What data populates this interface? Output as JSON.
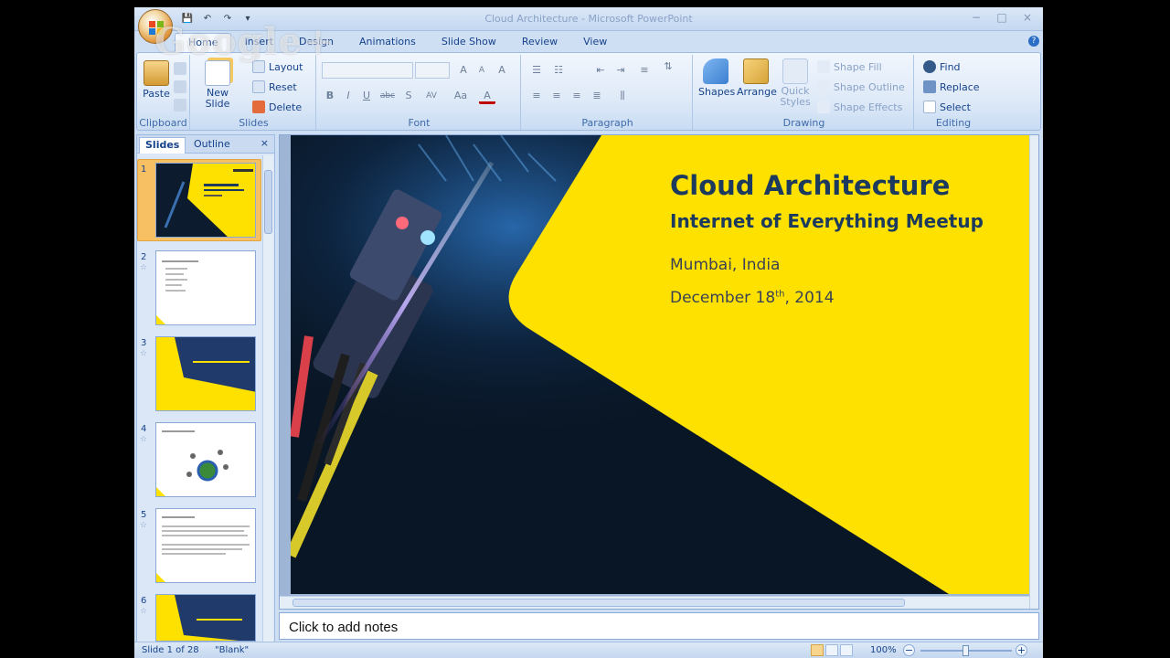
{
  "window": {
    "title": "Cloud Architecture - Microsoft PowerPoint",
    "watermark": "Google+",
    "min": "−",
    "max": "□",
    "close": "×"
  },
  "qat": {
    "save": "💾",
    "undo": "↶",
    "redo": "↷",
    "more": "▾"
  },
  "tabs": [
    "Home",
    "Insert",
    "Design",
    "Animations",
    "Slide Show",
    "Review",
    "View"
  ],
  "ribbon": {
    "clipboard": {
      "label": "Clipboard",
      "paste": "Paste"
    },
    "slides": {
      "label": "Slides",
      "new_slide": "New Slide",
      "new_slide_arrow": "▾",
      "layout": "Layout",
      "reset": "Reset",
      "delete": "Delete"
    },
    "font": {
      "label": "Font",
      "grow": "A",
      "shrink": "A",
      "clear": "A",
      "bold": "B",
      "italic": "I",
      "underline": "U",
      "strike": "abc",
      "shadow": "S",
      "spacing": "AV",
      "case": "Aa",
      "color": "A"
    },
    "paragraph": {
      "label": "Paragraph"
    },
    "drawing": {
      "label": "Drawing",
      "shapes": "Shapes",
      "arrange": "Arrange",
      "quick_styles": "Quick Styles",
      "shape_fill": "Shape Fill",
      "shape_outline": "Shape Outline",
      "shape_effects": "Shape Effects"
    },
    "editing": {
      "label": "Editing",
      "find": "Find",
      "replace": "Replace",
      "select": "Select"
    }
  },
  "slides_pane": {
    "tab_slides": "Slides",
    "tab_outline": "Outline",
    "close": "×",
    "thumbnails": [
      {
        "num": "1",
        "title": "Cloud Architecture"
      },
      {
        "num": "2",
        "title": ""
      },
      {
        "num": "3",
        "title": "Introduction: Internet of Things"
      },
      {
        "num": "4",
        "title": ""
      },
      {
        "num": "5",
        "title": ""
      },
      {
        "num": "6",
        "title": "Introduction: IoT Cloud"
      }
    ]
  },
  "slide": {
    "title": "Cloud Architecture",
    "subtitle": "Internet of Everything Meetup",
    "location": "Mumbai, India",
    "date_prefix": "December 18",
    "date_sup": "th",
    "date_suffix": ", 2014",
    "accent_color": "#ffe100",
    "text_color": "#1b3a5e"
  },
  "notes": {
    "placeholder": "Click to add notes"
  },
  "statusbar": {
    "slide_info": "Slide 1 of 28",
    "theme": "\"Blank\"",
    "zoom": "100%",
    "zoom_out": "−",
    "zoom_in": "+"
  }
}
